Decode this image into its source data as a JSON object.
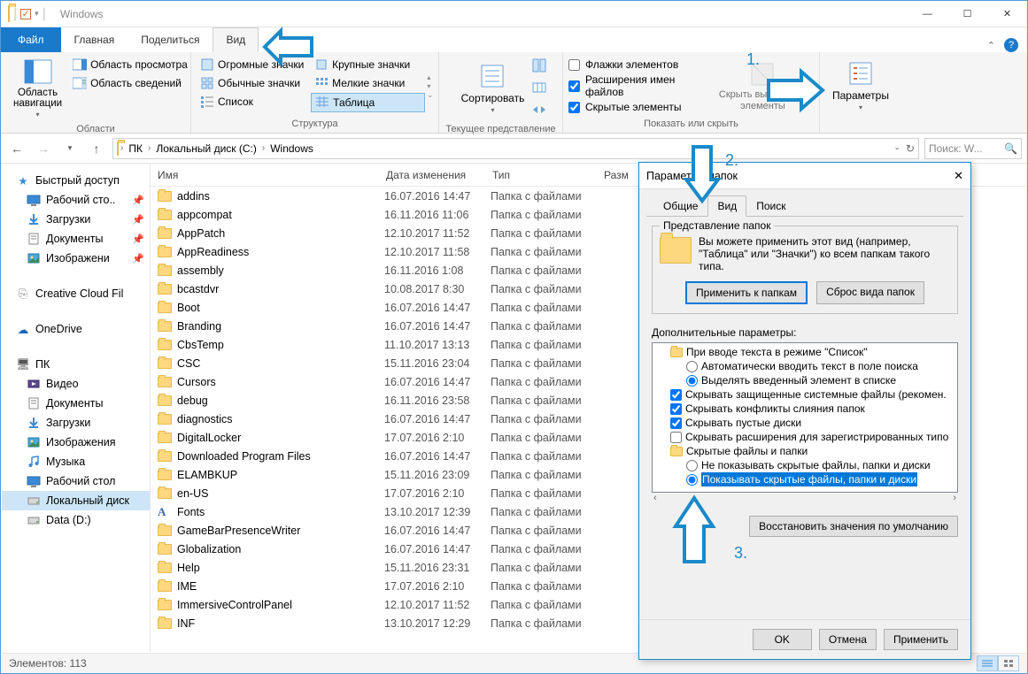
{
  "window": {
    "title": "Windows"
  },
  "tabs": {
    "file": "Файл",
    "home": "Главная",
    "share": "Поделиться",
    "view": "Вид"
  },
  "ribbon": {
    "panes": {
      "nav_pane": "Область навигации",
      "preview": "Область просмотра",
      "details": "Область сведений",
      "group_label": "Области"
    },
    "layouts": {
      "huge": "Огромные значки",
      "large_icons": "Крупные значки",
      "normal": "Обычные значки",
      "small_icons": "Мелкие значки",
      "list": "Список",
      "table": "Таблица",
      "group_label": "Структура"
    },
    "current_view": {
      "sort": "Сортировать",
      "group_label": "Текущее представление"
    },
    "show_hide": {
      "checkboxes": "Флажки элементов",
      "extensions": "Расширения имен файлов",
      "hidden": "Скрытые элементы",
      "hide_selected_l1": "Скрыть выбранные",
      "hide_selected_l2": "элементы",
      "group_label": "Показать или скрыть"
    },
    "options": "Параметры"
  },
  "breadcrumb": {
    "pc": "ПК",
    "disk": "Локальный диск (C:)",
    "folder": "Windows"
  },
  "search_placeholder": "Поиск: W...",
  "columns": {
    "name": "Имя",
    "date": "Дата изменения",
    "type": "Тип",
    "size": "Разм"
  },
  "folder_type": "Папка с файлами",
  "sidebar": {
    "quick": "Быстрый доступ",
    "quick_items": [
      {
        "label": "Рабочий сто..",
        "icon": "desktop"
      },
      {
        "label": "Загрузки",
        "icon": "downloads"
      },
      {
        "label": "Документы",
        "icon": "documents"
      },
      {
        "label": "Изображени",
        "icon": "pictures"
      }
    ],
    "ccf": "Creative Cloud Fil",
    "onedrive": "OneDrive",
    "pc": "ПК",
    "pc_items": [
      {
        "label": "Видео",
        "icon": "video"
      },
      {
        "label": "Документы",
        "icon": "documents"
      },
      {
        "label": "Загрузки",
        "icon": "downloads"
      },
      {
        "label": "Изображения",
        "icon": "pictures"
      },
      {
        "label": "Музыка",
        "icon": "music"
      },
      {
        "label": "Рабочий стол",
        "icon": "desktop"
      },
      {
        "label": "Локальный диск",
        "icon": "disk",
        "selected": true
      },
      {
        "label": "Data (D:)",
        "icon": "disk"
      }
    ]
  },
  "files": [
    {
      "name": "addins",
      "date": "16.07.2016 14:47"
    },
    {
      "name": "appcompat",
      "date": "16.11.2016 11:06"
    },
    {
      "name": "AppPatch",
      "date": "12.10.2017 11:52"
    },
    {
      "name": "AppReadiness",
      "date": "12.10.2017 11:58"
    },
    {
      "name": "assembly",
      "date": "16.11.2016 1:08"
    },
    {
      "name": "bcastdvr",
      "date": "10.08.2017 8:30"
    },
    {
      "name": "Boot",
      "date": "16.07.2016 14:47"
    },
    {
      "name": "Branding",
      "date": "16.07.2016 14:47"
    },
    {
      "name": "CbsTemp",
      "date": "11.10.2017 13:13"
    },
    {
      "name": "CSC",
      "date": "15.11.2016 23:04"
    },
    {
      "name": "Cursors",
      "date": "16.07.2016 14:47"
    },
    {
      "name": "debug",
      "date": "16.11.2016 23:58"
    },
    {
      "name": "diagnostics",
      "date": "16.07.2016 14:47"
    },
    {
      "name": "DigitalLocker",
      "date": "17.07.2016 2:10"
    },
    {
      "name": "Downloaded Program Files",
      "date": "16.07.2016 14:47"
    },
    {
      "name": "ELAMBKUP",
      "date": "15.11.2016 23:09"
    },
    {
      "name": "en-US",
      "date": "17.07.2016 2:10"
    },
    {
      "name": "Fonts",
      "date": "13.10.2017 12:39",
      "font": true
    },
    {
      "name": "GameBarPresenceWriter",
      "date": "16.07.2016 14:47"
    },
    {
      "name": "Globalization",
      "date": "16.07.2016 14:47"
    },
    {
      "name": "Help",
      "date": "15.11.2016 23:31"
    },
    {
      "name": "IME",
      "date": "17.07.2016 2:10"
    },
    {
      "name": "ImmersiveControlPanel",
      "date": "12.10.2017 11:52"
    },
    {
      "name": "INF",
      "date": "13.10.2017 12:29"
    }
  ],
  "statusbar": {
    "count": "Элементов: 113"
  },
  "dialog": {
    "title": "Параметры папок",
    "tabs": {
      "general": "Общие",
      "view": "Вид",
      "search": "Поиск"
    },
    "folder_views": {
      "legend": "Представление папок",
      "text": "Вы можете применить этот вид (например, \"Таблица\" или \"Значки\") ко всем папкам такого типа.",
      "apply": "Применить к папкам",
      "reset": "Сброс вида папок"
    },
    "advanced_label": "Дополнительные параметры:",
    "advanced": {
      "list_header": "При вводе текста в режиме \"Список\"",
      "auto_search": "Автоматически вводить текст в поле поиска",
      "highlight": "Выделять введенный элемент в списке",
      "hide_protected": "Скрывать защищенные системные файлы (рекомен.",
      "hide_merge": "Скрывать конфликты слияния папок",
      "hide_empty": "Скрывать пустые диски",
      "hide_ext": "Скрывать расширения для зарегистрированных типо",
      "hidden_header": "Скрытые файлы и папки",
      "dont_show": "Не показывать скрытые файлы, папки и диски",
      "show_hidden": "Показывать скрытые файлы, папки и диски"
    },
    "restore_defaults": "Восстановить значения по умолчанию",
    "ok": "OK",
    "cancel": "Отмена",
    "apply": "Применить"
  },
  "annotations": {
    "n1": "1.",
    "n2": "2.",
    "n3": "3."
  }
}
